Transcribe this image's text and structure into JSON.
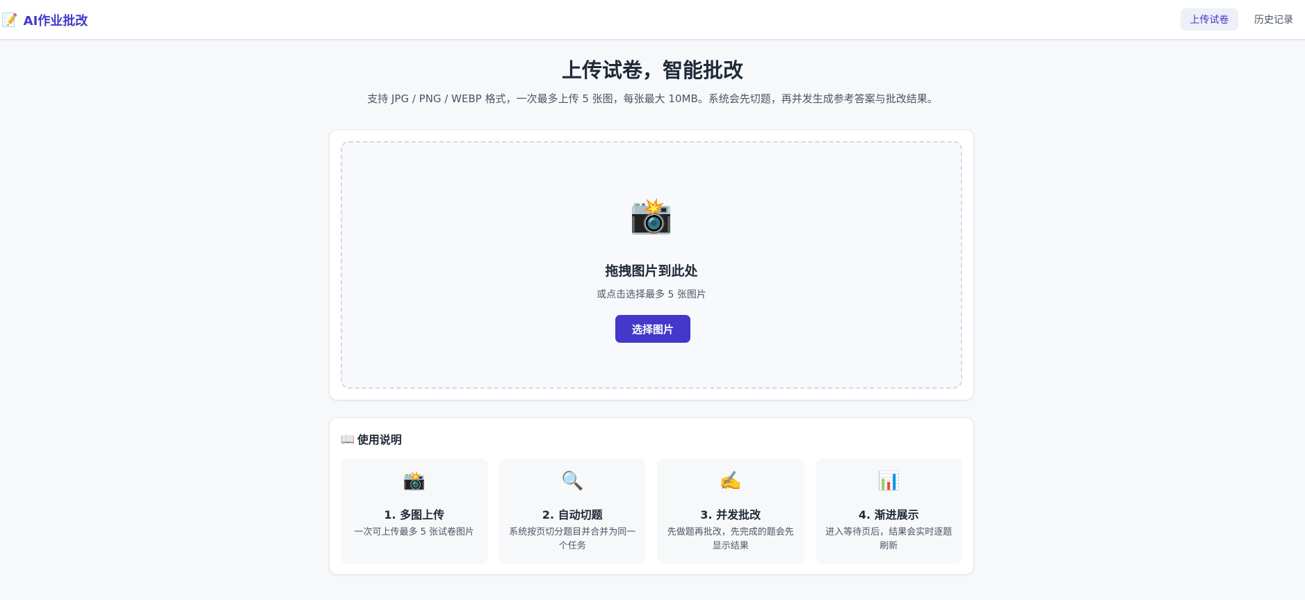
{
  "header": {
    "brand_icon": "memo-icon",
    "brand_name": "AI作业批改",
    "nav": {
      "upload": "上传试卷",
      "history": "历史记录"
    }
  },
  "hero": {
    "title": "上传试卷，智能批改",
    "subtitle": "支持 JPG / PNG / WEBP 格式，一次最多上传 5 张图，每张最大 10MB。系统会先切题，再并发生成参考答案与批改结果。"
  },
  "dropzone": {
    "icon": "camera-flash-icon",
    "title": "拖拽图片到此处",
    "hint": "或点击选择最多 5 张图片",
    "button_label": "选择图片"
  },
  "guide": {
    "icon": "open-book-icon",
    "heading": "使用说明",
    "steps": [
      {
        "icon": "camera-flash-icon",
        "title": "1. 多图上传",
        "desc": "一次可上传最多 5 张试卷图片"
      },
      {
        "icon": "magnifier-icon",
        "title": "2. 自动切题",
        "desc": "系统按页切分题目并合并为同一个任务"
      },
      {
        "icon": "writing-hand-icon",
        "title": "3. 并发批改",
        "desc": "先做题再批改，先完成的题会先显示结果"
      },
      {
        "icon": "bar-chart-icon",
        "title": "4. 渐进展示",
        "desc": "进入等待页后，结果会实时逐题刷新"
      }
    ]
  },
  "colors": {
    "accent": "#4338ca",
    "page_bg": "#f7f8fa",
    "nav_active_bg": "#eef0f8"
  }
}
